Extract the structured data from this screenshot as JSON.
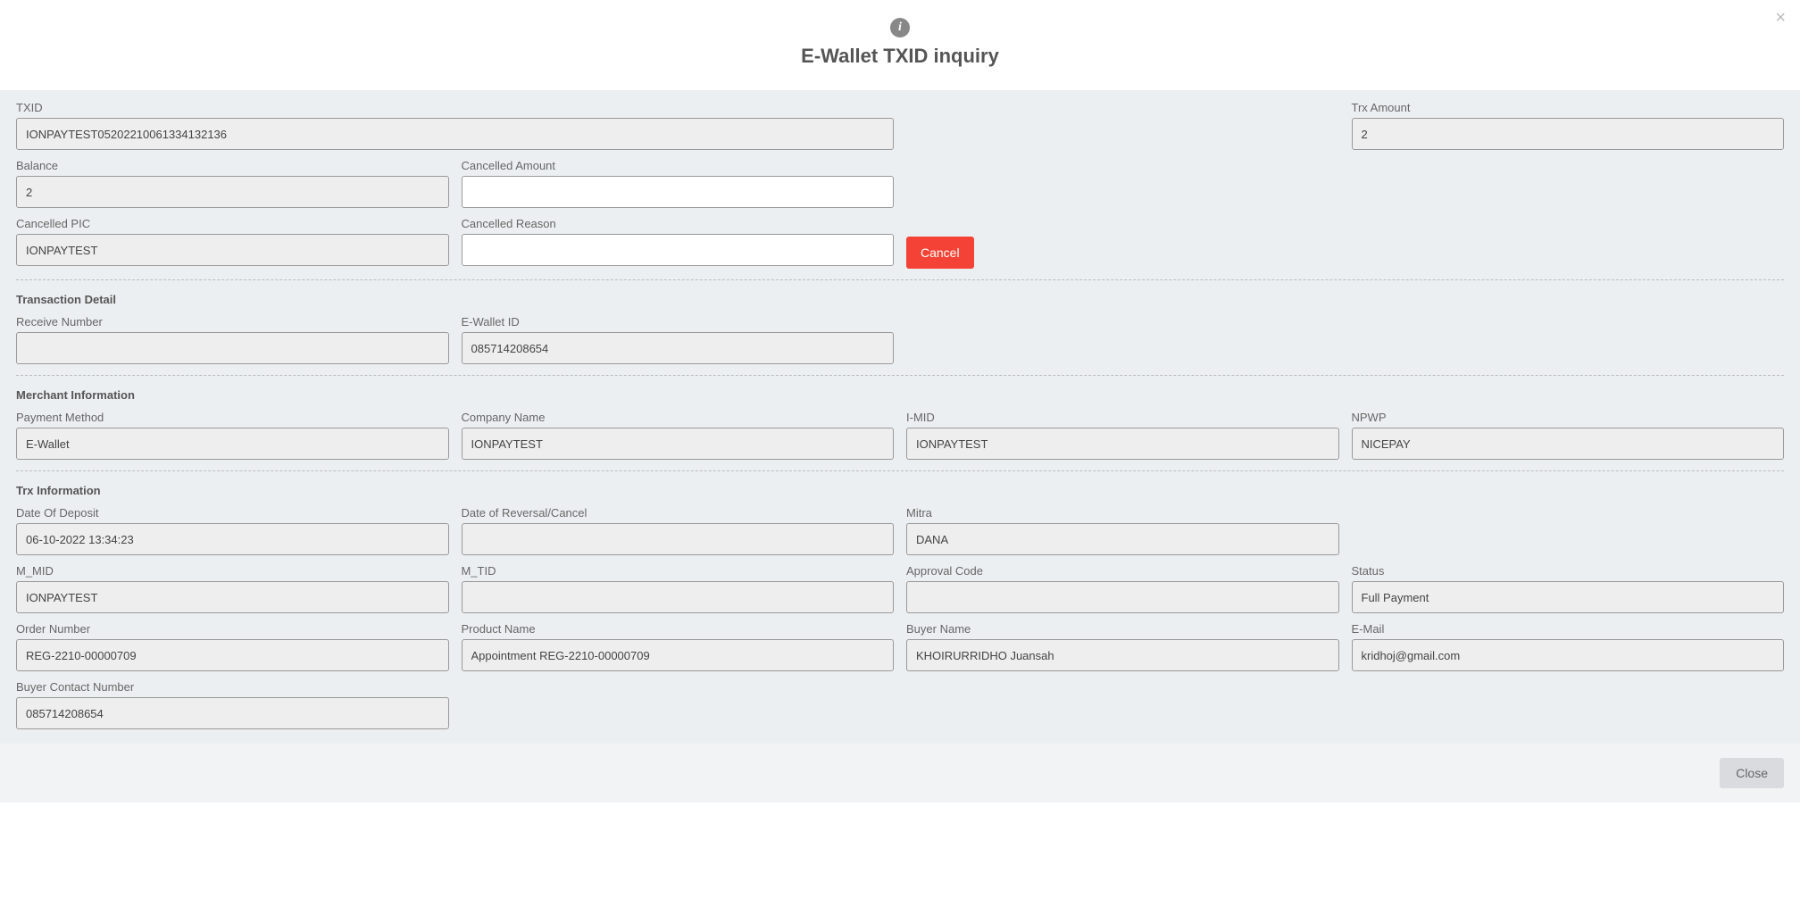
{
  "header": {
    "title": "E-Wallet TXID inquiry",
    "close_x": "×"
  },
  "top": {
    "txid_label": "TXID",
    "txid_value": "IONPAYTEST05202210061334132136",
    "trx_amount_label": "Trx Amount",
    "trx_amount_value": "2",
    "balance_label": "Balance",
    "balance_value": "2",
    "cancelled_amount_label": "Cancelled Amount",
    "cancelled_amount_value": "",
    "cancelled_pic_label": "Cancelled PIC",
    "cancelled_pic_value": "IONPAYTEST",
    "cancelled_reason_label": "Cancelled Reason",
    "cancelled_reason_value": "",
    "cancel_button": "Cancel"
  },
  "transaction_detail": {
    "section": "Transaction Detail",
    "receive_number_label": "Receive Number",
    "receive_number_value": "",
    "ewallet_id_label": "E-Wallet ID",
    "ewallet_id_value": "085714208654"
  },
  "merchant_info": {
    "section": "Merchant Information",
    "payment_method_label": "Payment Method",
    "payment_method_value": "E-Wallet",
    "company_name_label": "Company Name",
    "company_name_value": "IONPAYTEST",
    "imid_label": "I-MID",
    "imid_value": "IONPAYTEST",
    "npwp_label": "NPWP",
    "npwp_value": "NICEPAY"
  },
  "trx_info": {
    "section": "Trx Information",
    "date_of_deposit_label": "Date Of Deposit",
    "date_of_deposit_value": "06-10-2022 13:34:23",
    "date_of_reversal_label": "Date of Reversal/Cancel",
    "date_of_reversal_value": "",
    "mitra_label": "Mitra",
    "mitra_value": "DANA",
    "m_mid_label": "M_MID",
    "m_mid_value": "IONPAYTEST",
    "m_tid_label": "M_TID",
    "m_tid_value": "",
    "approval_code_label": "Approval Code",
    "approval_code_value": "",
    "status_label": "Status",
    "status_value": "Full Payment",
    "order_number_label": "Order Number",
    "order_number_value": "REG-2210-00000709",
    "product_name_label": "Product Name",
    "product_name_value": "Appointment REG-2210-00000709",
    "buyer_name_label": "Buyer Name",
    "buyer_name_value": "KHOIRURRIDHO Juansah",
    "email_label": "E-Mail",
    "email_value": "kridhoj@gmail.com",
    "buyer_contact_label": "Buyer Contact Number",
    "buyer_contact_value": "085714208654"
  },
  "footer": {
    "close_button": "Close"
  }
}
